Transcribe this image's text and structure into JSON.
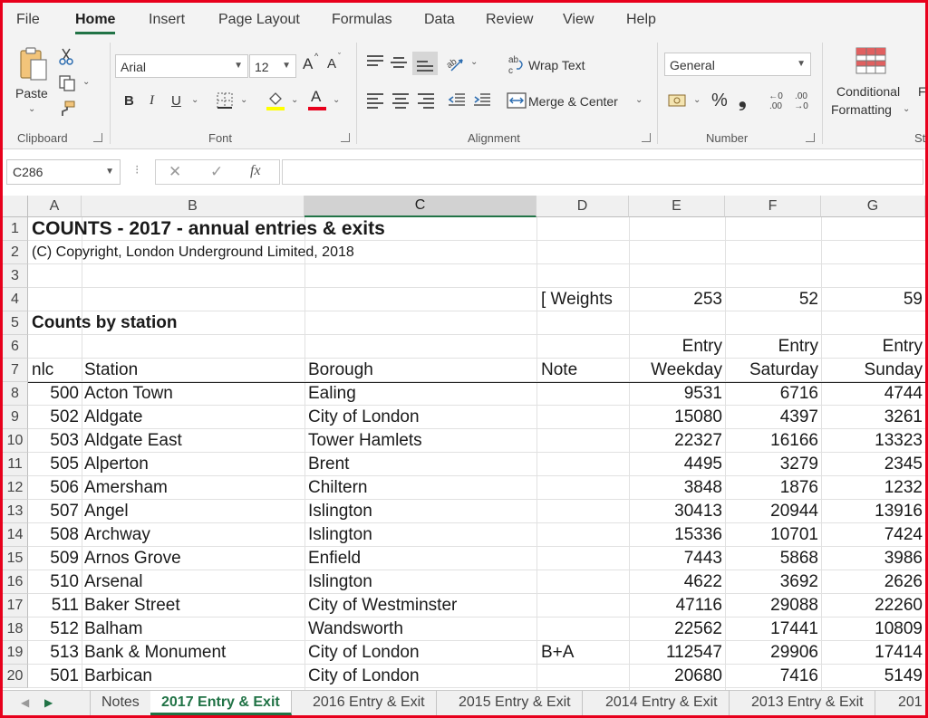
{
  "ribbon_tabs": [
    "File",
    "Home",
    "Insert",
    "Page Layout",
    "Formulas",
    "Data",
    "Review",
    "View",
    "Help"
  ],
  "active_tab": "Home",
  "clipboard": {
    "paste_label": "Paste",
    "group_label": "Clipboard"
  },
  "font": {
    "name": "Arial",
    "size": "12",
    "group_label": "Font",
    "bold": "B",
    "italic": "I",
    "underline": "U",
    "grow": "A",
    "shrink": "A",
    "font_color_letter": "A",
    "highlight_color": "#ffff00",
    "font_color": "#e8001c"
  },
  "alignment": {
    "wrap_text": "Wrap Text",
    "merge_center": "Merge & Center",
    "group_label": "Alignment"
  },
  "number": {
    "format": "General",
    "group_label": "Number",
    "percent": "%",
    "comma": "❟",
    "inc_decimal_top": "←0",
    "inc_decimal_bottom": ".00",
    "dec_decimal_top": ".00",
    "dec_decimal_bottom": "→0"
  },
  "styles": {
    "conditional_line1": "Conditional",
    "conditional_line2": "Formatting",
    "next_partial": "F",
    "group_partial": "St"
  },
  "formula_bar": {
    "name_box": "C286",
    "cancel": "✕",
    "enter": "✓",
    "fx": "fx",
    "value": ""
  },
  "columns": [
    "A",
    "B",
    "C",
    "D",
    "E",
    "F",
    "G"
  ],
  "selected_column": "C",
  "row_numbers": [
    "1",
    "2",
    "3",
    "4",
    "5",
    "6",
    "7",
    "8",
    "9",
    "10",
    "11",
    "12",
    "13",
    "14",
    "15",
    "16",
    "17",
    "18",
    "19",
    "20"
  ],
  "sheet": {
    "title": "COUNTS - 2017 - annual entries & exits",
    "copyright": "(C) Copyright, London Underground Limited, 2018",
    "weights_label": "[ Weights",
    "weights": [
      "253",
      "52",
      "59"
    ],
    "section_title": "Counts by station",
    "entry_labels": [
      "Entry",
      "Entry",
      "Entry"
    ],
    "headers": {
      "nlc": "nlc",
      "station": "Station",
      "borough": "Borough",
      "note": "Note",
      "weekday": "Weekday",
      "saturday": "Saturday",
      "sunday": "Sunday"
    },
    "rows": [
      {
        "nlc": "500",
        "station": "Acton Town",
        "borough": "Ealing",
        "note": "",
        "weekday": "9531",
        "saturday": "6716",
        "sunday": "4744"
      },
      {
        "nlc": "502",
        "station": "Aldgate",
        "borough": "City of London",
        "note": "",
        "weekday": "15080",
        "saturday": "4397",
        "sunday": "3261"
      },
      {
        "nlc": "503",
        "station": "Aldgate East",
        "borough": "Tower Hamlets",
        "note": "",
        "weekday": "22327",
        "saturday": "16166",
        "sunday": "13323"
      },
      {
        "nlc": "505",
        "station": "Alperton",
        "borough": "Brent",
        "note": "",
        "weekday": "4495",
        "saturday": "3279",
        "sunday": "2345"
      },
      {
        "nlc": "506",
        "station": "Amersham",
        "borough": "Chiltern",
        "note": "",
        "weekday": "3848",
        "saturday": "1876",
        "sunday": "1232"
      },
      {
        "nlc": "507",
        "station": "Angel",
        "borough": "Islington",
        "note": "",
        "weekday": "30413",
        "saturday": "20944",
        "sunday": "13916"
      },
      {
        "nlc": "508",
        "station": "Archway",
        "borough": "Islington",
        "note": "",
        "weekday": "15336",
        "saturday": "10701",
        "sunday": "7424"
      },
      {
        "nlc": "509",
        "station": "Arnos Grove",
        "borough": "Enfield",
        "note": "",
        "weekday": "7443",
        "saturday": "5868",
        "sunday": "3986"
      },
      {
        "nlc": "510",
        "station": "Arsenal",
        "borough": "Islington",
        "note": "",
        "weekday": "4622",
        "saturday": "3692",
        "sunday": "2626"
      },
      {
        "nlc": "511",
        "station": "Baker Street",
        "borough": "City of Westminster",
        "note": "",
        "weekday": "47116",
        "saturday": "29088",
        "sunday": "22260"
      },
      {
        "nlc": "512",
        "station": "Balham",
        "borough": "Wandsworth",
        "note": "",
        "weekday": "22562",
        "saturday": "17441",
        "sunday": "10809"
      },
      {
        "nlc": "513",
        "station": "Bank & Monument",
        "borough": "City of London",
        "note": "B+A",
        "weekday": "112547",
        "saturday": "29906",
        "sunday": "17414"
      },
      {
        "nlc": "501",
        "station": "Barbican",
        "borough": "City of London",
        "note": "",
        "weekday": "20680",
        "saturday": "7416",
        "sunday": "5149"
      }
    ]
  },
  "sheet_tabs": [
    "Notes",
    "2017 Entry & Exit",
    "2016 Entry & Exit",
    "2015 Entry & Exit",
    "2014 Entry & Exit",
    "2013 Entry & Exit",
    "201"
  ],
  "active_sheet": "2017 Entry & Exit",
  "colors": {
    "accent_green": "#217346",
    "frame_red": "#e8001c"
  }
}
